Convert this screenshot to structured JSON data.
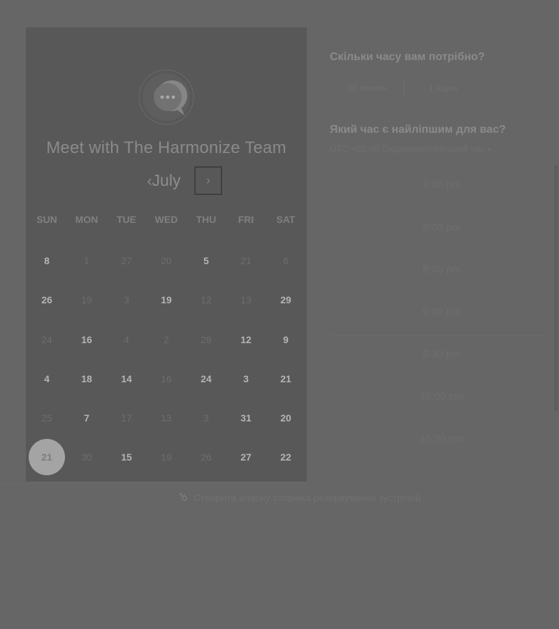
{
  "calendar": {
    "title": "Meet with The Harmonize Team",
    "month": "July",
    "prev_glyph": "‹",
    "next_glyph": "›",
    "weekdays": [
      "SUN",
      "MON",
      "TUE",
      "WED",
      "THU",
      "FRI",
      "SAT"
    ],
    "weeks": [
      [
        {
          "d": "8",
          "s": "avail"
        },
        {
          "d": "1",
          "s": "unavail"
        },
        {
          "d": "27",
          "s": "unavail"
        },
        {
          "d": "20",
          "s": "unavail"
        },
        {
          "d": "5",
          "s": "avail"
        },
        {
          "d": "21",
          "s": "unavail"
        },
        {
          "d": "6",
          "s": "unavail"
        }
      ],
      [
        {
          "d": "26",
          "s": "avail"
        },
        {
          "d": "19",
          "s": "unavail"
        },
        {
          "d": "3",
          "s": "unavail"
        },
        {
          "d": "19",
          "s": "avail"
        },
        {
          "d": "12",
          "s": "unavail"
        },
        {
          "d": "13",
          "s": "unavail"
        },
        {
          "d": "29",
          "s": "avail"
        }
      ],
      [
        {
          "d": "24",
          "s": "unavail"
        },
        {
          "d": "16",
          "s": "avail"
        },
        {
          "d": "4",
          "s": "unavail"
        },
        {
          "d": "2",
          "s": "unavail"
        },
        {
          "d": "28",
          "s": "unavail"
        },
        {
          "d": "12",
          "s": "avail"
        },
        {
          "d": "9",
          "s": "avail"
        }
      ],
      [
        {
          "d": "4",
          "s": "avail"
        },
        {
          "d": "18",
          "s": "avail"
        },
        {
          "d": "14",
          "s": "avail"
        },
        {
          "d": "16",
          "s": "unavail"
        },
        {
          "d": "24",
          "s": "avail"
        },
        {
          "d": "3",
          "s": "avail"
        },
        {
          "d": "21",
          "s": "avail"
        }
      ],
      [
        {
          "d": "25",
          "s": "unavail"
        },
        {
          "d": "7",
          "s": "avail"
        },
        {
          "d": "17",
          "s": "unavail"
        },
        {
          "d": "13",
          "s": "unavail"
        },
        {
          "d": "3",
          "s": "unavail"
        },
        {
          "d": "31",
          "s": "avail"
        },
        {
          "d": "20",
          "s": "avail"
        }
      ],
      [
        {
          "d": "21",
          "s": "selected"
        },
        {
          "d": "30",
          "s": "unavail"
        },
        {
          "d": "15",
          "s": "avail"
        },
        {
          "d": "19",
          "s": "unavail"
        },
        {
          "d": "26",
          "s": "unavail"
        },
        {
          "d": "27",
          "s": "avail"
        },
        {
          "d": "22",
          "s": "avail"
        }
      ]
    ]
  },
  "booking": {
    "duration_question": "Скільки часу вам потрібно?",
    "durations": [
      "30 хвилин",
      "1 годин"
    ],
    "time_question": "Який час є найліпшим для вас?",
    "timezone": "UTC +02:00 Східноєвропейський час",
    "timezone_caret": "▾",
    "slots": [
      "7:30 pm",
      "8:00 pm",
      "8:30 pm",
      "9:00 pm",
      "9:30 pm",
      "10:00 pm",
      "10:30 pm"
    ]
  },
  "footer": {
    "icon": "sprocket-icon",
    "link": "Створити власну сторінка резервування зустрічей"
  },
  "colors": {
    "background": "#666666",
    "calendar_panel": "#585858",
    "selected_day": "#a4a4a4"
  }
}
